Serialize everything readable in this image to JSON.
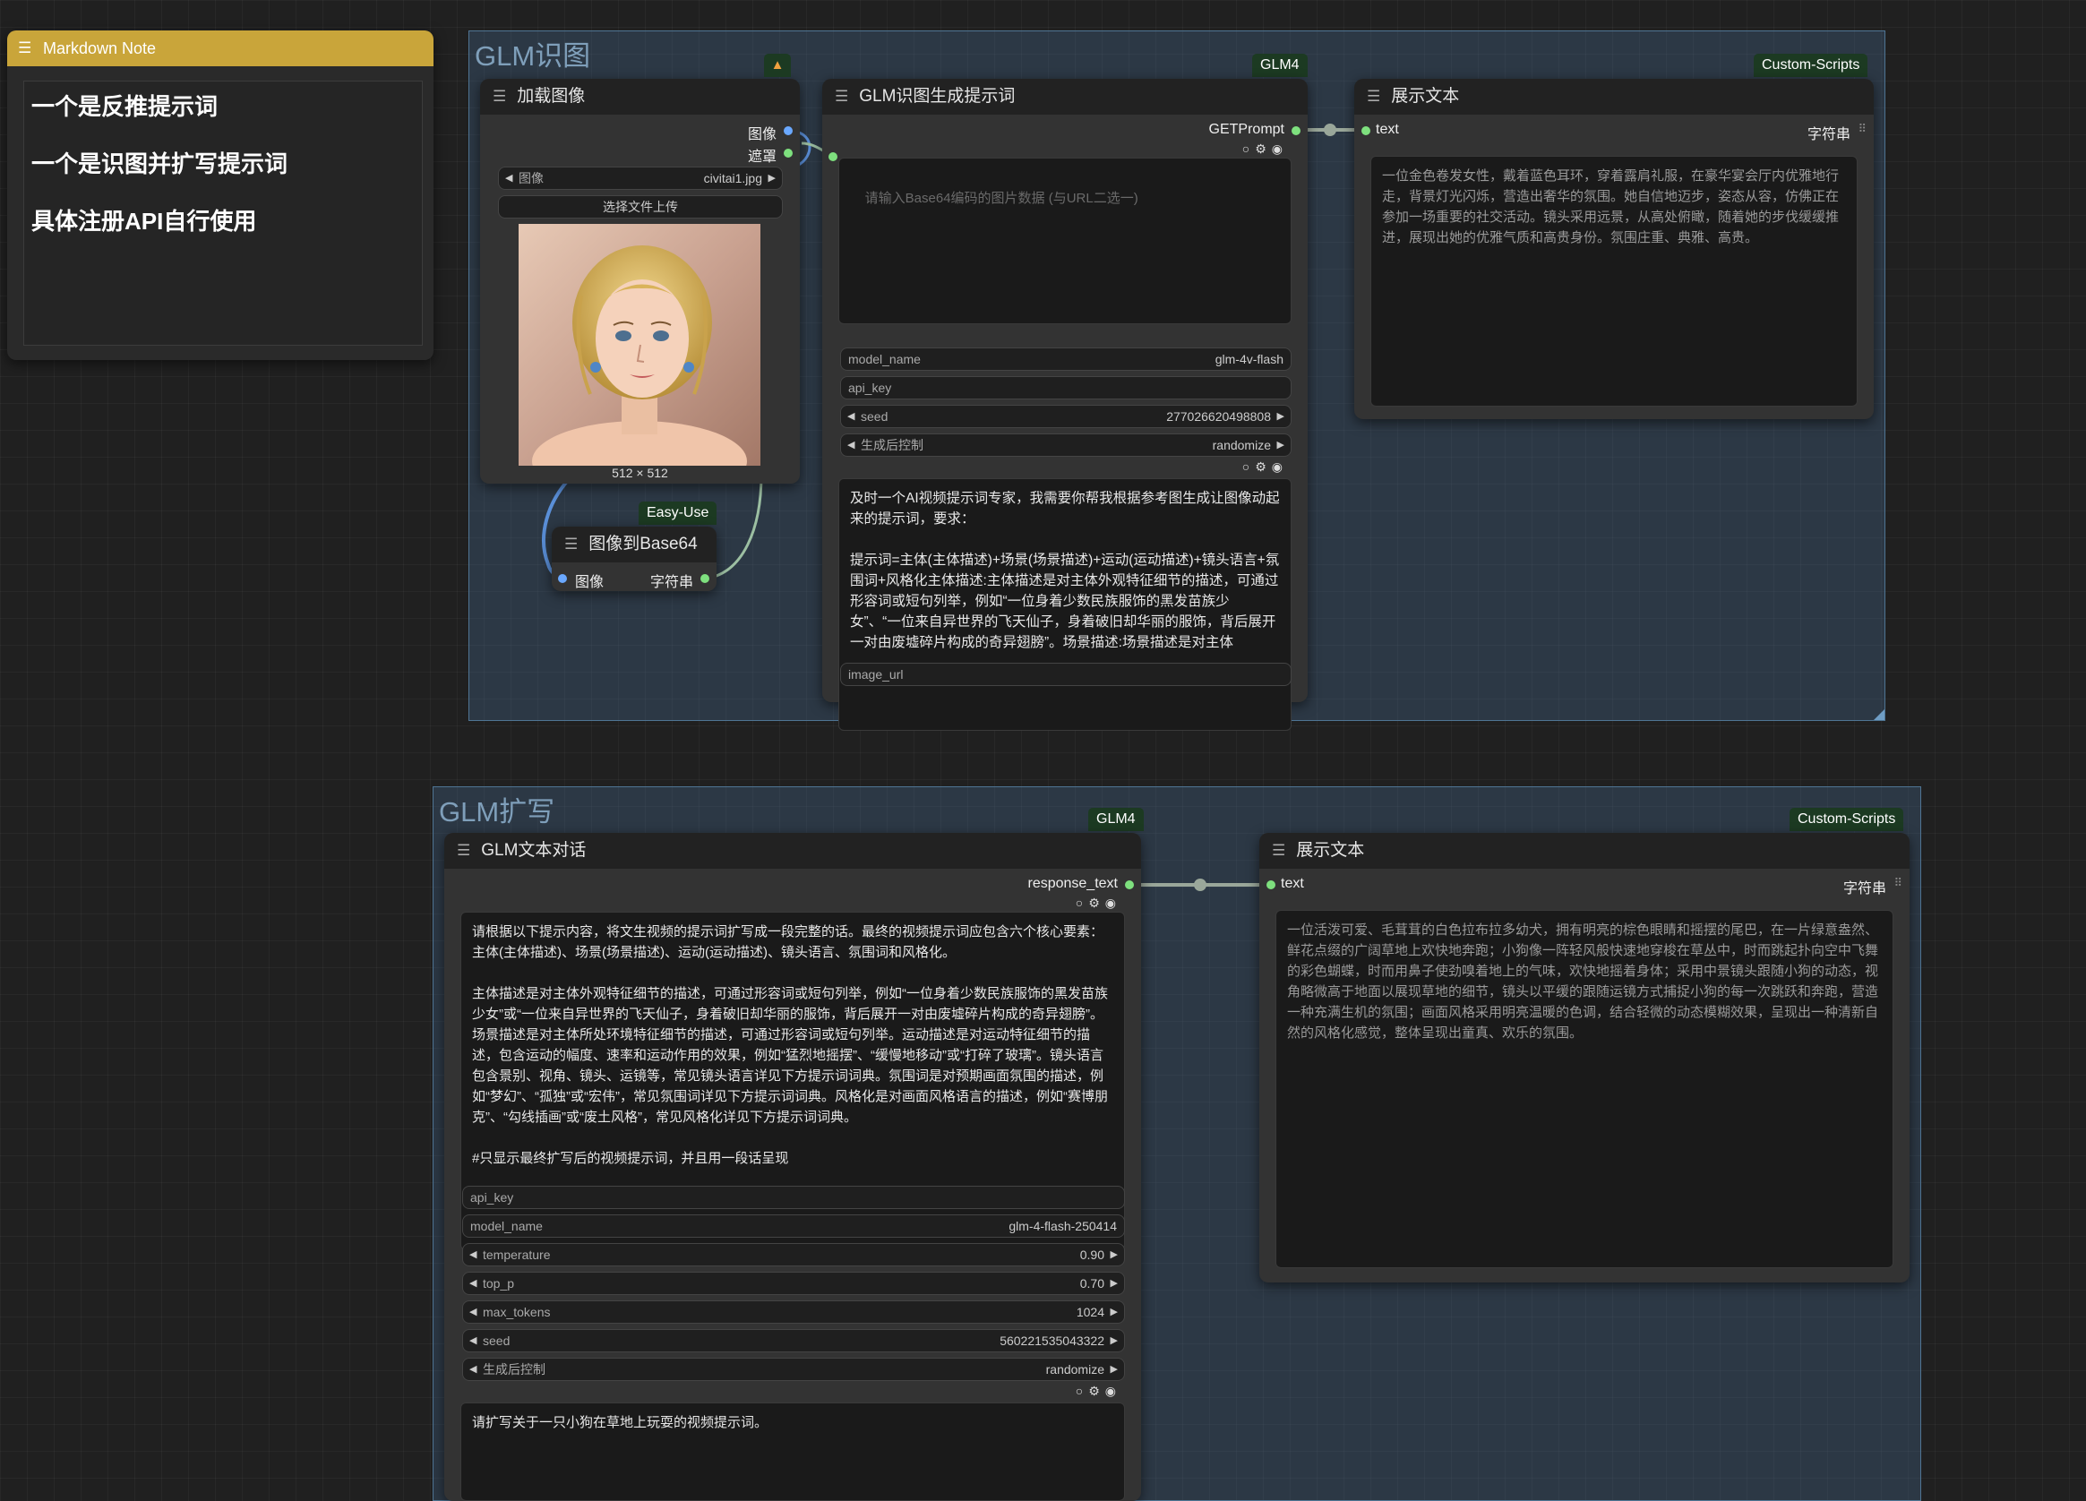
{
  "markdown_note": {
    "title": "Markdown Note",
    "lines": [
      "一个是反推提示词",
      "一个是识图并扩写提示词",
      "具体注册API自行使用"
    ]
  },
  "group_top": {
    "title": "GLM识图"
  },
  "group_bottom": {
    "title": "GLM扩写"
  },
  "load_image": {
    "title": "加载图像",
    "out_image": "图像",
    "out_mask": "遮罩",
    "image_label": "图像",
    "image_value": "civitai1.jpg",
    "upload_label": "选择文件上传",
    "size_text": "512 × 512"
  },
  "base64_node": {
    "badge": "Easy-Use",
    "title": "图像到Base64",
    "in_label": "图像",
    "out_label": "字符串"
  },
  "glm_vision": {
    "badge": "GLM4",
    "title": "GLM识图生成提示词",
    "out_label": "GETPrompt",
    "placeholder": "请输入Base64编码的图片数据 (与URL二选一)",
    "model_name_label": "model_name",
    "model_name_value": "glm-4v-flash",
    "api_key_label": "api_key",
    "seed_label": "seed",
    "seed_value": "277026620498808",
    "control_label": "生成后控制",
    "control_value": "randomize",
    "prompt_text": "及时一个AI视频提示词专家，我需要你帮我根据参考图生成让图像动起来的提示词，要求：\n\n提示词=主体(主体描述)+场景(场景描述)+运动(运动描述)+镜头语言+氛围词+风格化主体描述:主体描述是对主体外观特征细节的描述，可通过形容词或短句列举，例如“一位身着少数民族服饰的黑发苗族少女”、“一位来自异世界的飞天仙子，身着破旧却华丽的服饰，背后展开一对由废墟碎片构成的奇异翅膀”。场景描述:场景描述是对主体",
    "image_url_label": "image_url"
  },
  "show_text_top": {
    "badge": "Custom-Scripts",
    "title": "展示文本",
    "in_label": "text",
    "type_label": "字符串",
    "text": "一位金色卷发女性，戴着蓝色耳环，穿着露肩礼服，在豪华宴会厅内优雅地行走，背景灯光闪烁，营造出奢华的氛围。她自信地迈步，姿态从容，仿佛正在参加一场重要的社交活动。镜头采用远景，从高处俯瞰，随着她的步伐缓缓推进，展现出她的优雅气质和高贵身份。氛围庄重、典雅、高贵。"
  },
  "glm_chat": {
    "badge": "GLM4",
    "title": "GLM文本对话",
    "out_label": "response_text",
    "system_text": "请根据以下提示内容，将文生视频的提示词扩写成一段完整的话。最终的视频提示词应包含六个核心要素：主体(主体描述)、场景(场景描述)、运动(运动描述)、镜头语言、氛围词和风格化。\n\n主体描述是对主体外观特征细节的描述，可通过形容词或短句列举，例如“一位身着少数民族服饰的黑发苗族少女”或“一位来自异世界的飞天仙子，身着破旧却华丽的服饰，背后展开一对由废墟碎片构成的奇异翅膀”。场景描述是对主体所处环境特征细节的描述，可通过形容词或短句列举。运动描述是对运动特征细节的描述，包含运动的幅度、速率和运动作用的效果，例如“猛烈地摇摆”、“缓慢地移动”或“打碎了玻璃”。镜头语言包含景别、视角、镜头、运镜等，常见镜头语言详见下方提示词词典。氛围词是对预期画面氛围的描述，例如“梦幻”、“孤独”或“宏伟”，常见氛围词详见下方提示词词典。风格化是对画面风格语言的描述，例如“赛博朋克”、“勾线插画”或“废土风格”，常见风格化详见下方提示词词典。\n\n#只显示最终扩写后的视频提示词，并且用一段话呈现",
    "api_key_label": "api_key",
    "model_name_label": "model_name",
    "model_name_value": "glm-4-flash-250414",
    "temperature_label": "temperature",
    "temperature_value": "0.90",
    "top_p_label": "top_p",
    "top_p_value": "0.70",
    "max_tokens_label": "max_tokens",
    "max_tokens_value": "1024",
    "seed_label": "seed",
    "seed_value": "560221535043322",
    "control_label": "生成后控制",
    "control_value": "randomize",
    "user_text": "请扩写关于一只小狗在草地上玩耍的视频提示词。"
  },
  "show_text_bottom": {
    "badge": "Custom-Scripts",
    "title": "展示文本",
    "in_label": "text",
    "type_label": "字符串",
    "text": "一位活泼可爱、毛茸茸的白色拉布拉多幼犬，拥有明亮的棕色眼睛和摇摆的尾巴，在一片绿意盎然、鲜花点缀的广阔草地上欢快地奔跑；小狗像一阵轻风般快速地穿梭在草丛中，时而跳起扑向空中飞舞的彩色蝴蝶，时而用鼻子使劲嗅着地上的气味，欢快地摇着身体；采用中景镜头跟随小狗的动态，视角略微高于地面以展现草地的细节，镜头以平缓的跟随运镜方式捕捉小狗的每一次跳跃和奔跑，营造一种充满生机的氛围；画面风格采用明亮温暖的色调，结合轻微的动态模糊效果，呈现出一种清新自然的风格化感觉，整体呈现出童真、欢乐的氛围。"
  },
  "colors": {
    "slot_green": "#7ee07e",
    "slot_blue": "#6aa8ff",
    "note_header": "#c9a53a",
    "group_bg": "#3a5670"
  }
}
